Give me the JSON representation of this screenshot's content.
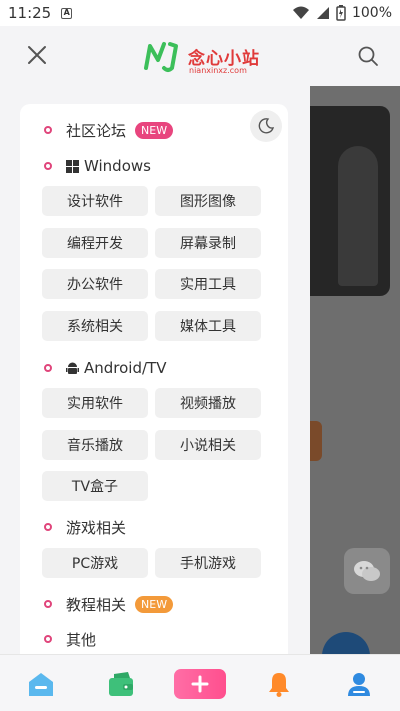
{
  "status_bar": {
    "time": "11:25",
    "notification": "A",
    "battery": "100%"
  },
  "header": {
    "logo_title": "念心小站",
    "logo_domain": "nianxinxz.com"
  },
  "menu": {
    "community": {
      "label": "社区论坛",
      "badge": "NEW"
    },
    "windows": {
      "label": "Windows",
      "items": [
        "设计软件",
        "图形图像",
        "编程开发",
        "屏幕录制",
        "办公软件",
        "实用工具",
        "系统相关",
        "媒体工具"
      ]
    },
    "android": {
      "label": "Android/TV",
      "items": [
        "实用软件",
        "视频播放",
        "音乐播放",
        "小说相关",
        "TV盒子"
      ]
    },
    "games": {
      "label": "游戏相关",
      "items": [
        "PC游戏",
        "手机游戏"
      ]
    },
    "tutorials": {
      "label": "教程相关",
      "badge": "NEW"
    },
    "others": {
      "label": "其他"
    }
  },
  "icons": {
    "close": "close-icon",
    "search": "search-icon",
    "moon": "moon-icon",
    "home": "home-icon",
    "wallet": "wallet-icon",
    "plus": "plus-icon",
    "bell": "bell-icon",
    "user": "user-icon",
    "wechat": "wechat-icon"
  },
  "colors": {
    "accent_pink": "#e8457e",
    "badge_orange": "#f39a3a",
    "home_blue": "#4aaee8",
    "green": "#3ec07a",
    "bell_orange": "#ff8a2a",
    "user_blue": "#2f8ae0"
  }
}
